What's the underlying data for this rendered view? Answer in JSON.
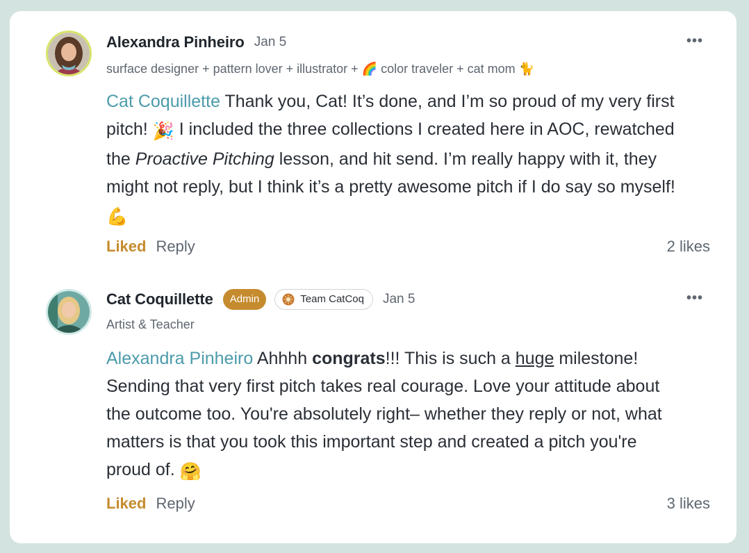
{
  "comments": [
    {
      "author": "Alexandra Pinheiro",
      "date": "Jan 5",
      "bio": "surface designer + pattern lover + illustrator + 🌈 color traveler + cat mom 🐈",
      "mention": "Cat Coquillette",
      "text_1": " Thank you, Cat! It’s done, and I’m so proud of my very first pitch! ",
      "emoji_1": "🎉",
      "text_2": " I included the three collections I created here in AOC, rewatched the ",
      "italic": "Proactive Pitching",
      "text_3": " lesson, and hit send. I’m really happy with it, they might not reply, but I think it’s a pretty awesome pitch if I do say so myself! ",
      "emoji_2": "💪",
      "liked_label": "Liked",
      "reply_label": "Reply",
      "likes": "2 likes",
      "more_icon": "more-horizontal-icon"
    },
    {
      "author": "Cat Coquillette",
      "badge": "Admin",
      "team": "Team CatCoq",
      "date": "Jan 5",
      "bio": "Artist & Teacher",
      "mention": "Alexandra Pinheiro",
      "text_1": " Ahhhh ",
      "bold": "congrats",
      "text_2": "!!! This is such a ",
      "underline": "huge",
      "text_3": " milestone! Sending that very first pitch takes real courage. Love your attitude about the outcome too. You're absolutely right– whether they reply or not, what matters is that you took this important step and created a pitch you're proud of. ",
      "emoji": "🤗",
      "liked_label": "Liked",
      "reply_label": "Reply",
      "likes": "3 likes",
      "more_icon": "more-horizontal-icon"
    }
  ],
  "colors": {
    "background": "#d3e3e0",
    "mention": "#4c9bab",
    "liked": "#c58b2e",
    "admin_badge": "#c58b2e"
  }
}
